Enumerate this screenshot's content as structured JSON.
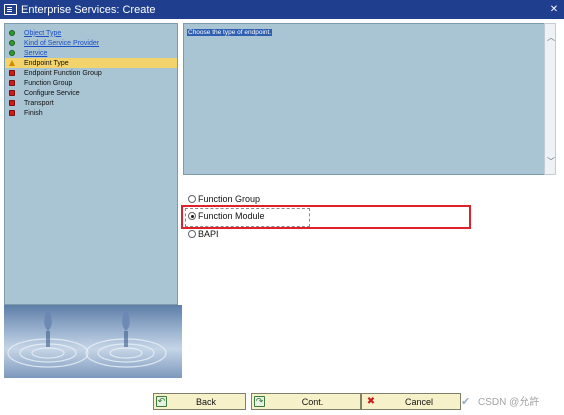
{
  "window": {
    "title": "Enterprise Services: Create"
  },
  "steps": [
    {
      "label": "Object Type",
      "state": "done"
    },
    {
      "label": "Kind of Service Provider",
      "state": "done"
    },
    {
      "label": "Service",
      "state": "done"
    },
    {
      "label": "Endpoint Type",
      "state": "current"
    },
    {
      "label": "Endpoint Function Group",
      "state": "todo"
    },
    {
      "label": "Function Group",
      "state": "todo"
    },
    {
      "label": "Configure Service",
      "state": "todo"
    },
    {
      "label": "Transport",
      "state": "todo"
    },
    {
      "label": "Finish",
      "state": "todo"
    }
  ],
  "description": {
    "text": "Choose the type of endpoint."
  },
  "endpoint_options": [
    {
      "label": "Function Group",
      "selected": false
    },
    {
      "label": "Function Module",
      "selected": true
    },
    {
      "label": "BAPI",
      "selected": false
    }
  ],
  "buttons": {
    "back": "Back",
    "cont": "Cont.",
    "cancel": "Cancel"
  },
  "watermark": "CSDN @允許",
  "colors": {
    "titlebar": "#1f3f8e",
    "panel": "#a9c4d2",
    "highlight": "#e0202a",
    "button": "#f6f1c9",
    "step_done": "#2f9b2f",
    "step_current": "#d08a00",
    "step_todo": "#cc1b1b"
  },
  "icons": {
    "window": "window-icon",
    "close": "close-icon",
    "back": "back-arrow-icon",
    "cont": "continue-arrow-icon",
    "cancel": "cancel-x-icon",
    "extra": "tick-pair-icon"
  }
}
